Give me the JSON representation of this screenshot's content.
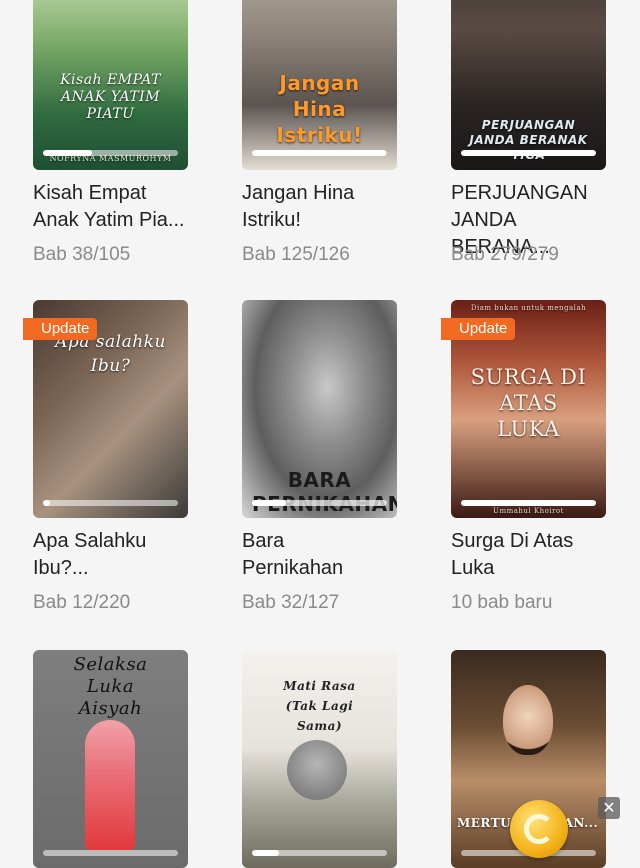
{
  "books": [
    {
      "cover_title": "Kisah EMPAT ANAK YATIM PIATU",
      "cover_author": "NOFRYNA MASMUROHYM",
      "title_line1": "Kisah Empat",
      "title_line2": "Anak Yatim Pia...",
      "meta": "Bab 38/105",
      "badge": "",
      "progress": 0.36
    },
    {
      "cover_title": "Jangan Hina Istriku!",
      "cover_author": "",
      "title_line1": "Jangan Hina",
      "title_line2": "Istriku!",
      "meta": "Bab 125/126",
      "badge": "",
      "progress": 0.99
    },
    {
      "cover_title": "PERJUANGAN JANDA BERANAK TIGA",
      "cover_author": "",
      "title_line1": "PERJUANGAN",
      "title_line2": "JANDA BERANA...",
      "meta": "Bab 279/279",
      "badge": "",
      "progress": 1.0
    },
    {
      "cover_title": "Apa salahku Ibu?",
      "cover_author": "",
      "title_line1": "Apa Salahku",
      "title_line2": "Ibu?...",
      "meta": "Bab 12/220",
      "badge": "Update",
      "progress": 0.05
    },
    {
      "cover_title": "BARA PERNIKAHAN",
      "cover_author": "",
      "title_line1": "Bara",
      "title_line2": "Pernikahan",
      "meta": "Bab 32/127",
      "badge": "",
      "progress": 0.25
    },
    {
      "cover_title": "SURGA DI ATAS LUKA",
      "cover_author": "Ummahul Khoirot",
      "cover_tagline": "Diam bukan untuk mengalah",
      "title_line1": "Surga Di Atas",
      "title_line2": "Luka",
      "meta": "10 bab baru",
      "badge": "Update",
      "progress": 1.0
    },
    {
      "cover_title": "Selaksa Luka Aisyah",
      "cover_author": "",
      "title_line1": "",
      "title_line2": "",
      "meta": "",
      "badge": "",
      "progress": 0.0
    },
    {
      "cover_title": "Mati Rasa (Tak Lagi Sama)",
      "cover_author": "",
      "title_line1": "",
      "title_line2": "",
      "meta": "",
      "badge": "",
      "progress": 0.2
    },
    {
      "cover_title": "MERTU... MENAN...",
      "cover_author": "",
      "title_line1": "",
      "title_line2": "",
      "meta": "",
      "badge": "",
      "progress": 0.0
    }
  ],
  "overlay": {
    "close_glyph": "✕",
    "close_icon": "close-icon",
    "coin_icon": "coin-reward-icon"
  },
  "colors": {
    "background": "#f5f5f5",
    "badge": "#f26a21",
    "title_text": "#222222",
    "meta_text": "#8a8a8a"
  }
}
